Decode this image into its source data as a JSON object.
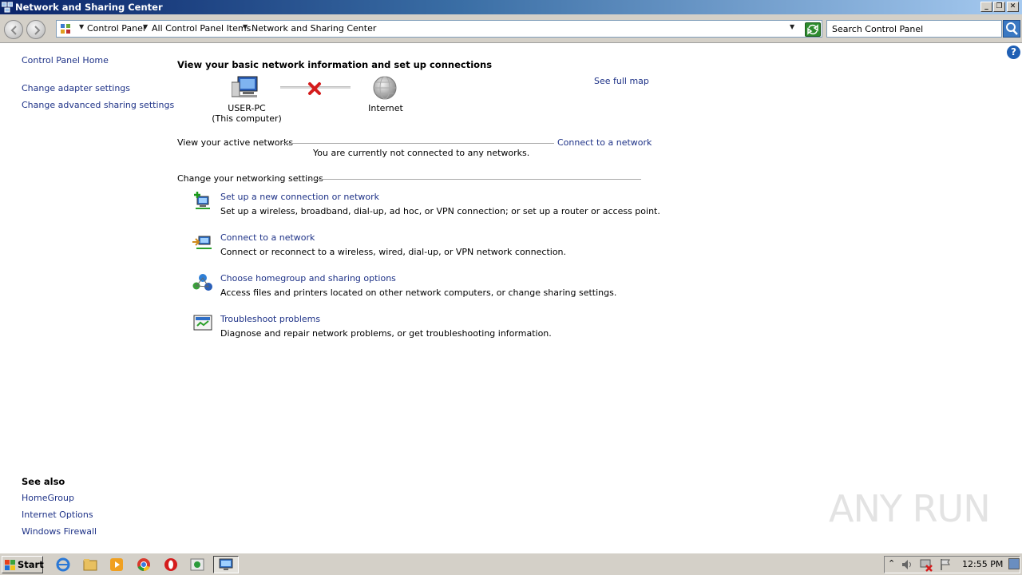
{
  "window": {
    "title": "Network and Sharing Center"
  },
  "address": {
    "crumbs": [
      "Control Panel",
      "All Control Panel Items",
      "Network and Sharing Center"
    ],
    "search_placeholder": "Search Control Panel"
  },
  "sidebar": {
    "home": "Control Panel Home",
    "links": [
      "Change adapter settings",
      "Change advanced sharing settings"
    ],
    "see_also_heading": "See also",
    "see_also": [
      "HomeGroup",
      "Internet Options",
      "Windows Firewall"
    ]
  },
  "main": {
    "title": "View your basic network information and set up connections",
    "see_full_map": "See full map",
    "computer_name": "USER-PC",
    "computer_sub": "(This computer)",
    "internet_label": "Internet",
    "active_heading": "View your active networks",
    "connect_link": "Connect to a network",
    "not_connected": "You are currently not connected to any networks.",
    "settings_heading": "Change your networking settings",
    "tasks": [
      {
        "link": "Set up a new connection or network",
        "desc": "Set up a wireless, broadband, dial-up, ad hoc, or VPN connection; or set up a router or access point.",
        "icon": "new-connection-icon"
      },
      {
        "link": "Connect to a network",
        "desc": "Connect or reconnect to a wireless, wired, dial-up, or VPN network connection.",
        "icon": "connect-network-icon"
      },
      {
        "link": "Choose homegroup and sharing options",
        "desc": "Access files and printers located on other network computers, or change sharing settings.",
        "icon": "homegroup-icon"
      },
      {
        "link": "Troubleshoot problems",
        "desc": "Diagnose and repair network problems, or get troubleshooting information.",
        "icon": "troubleshoot-icon"
      }
    ]
  },
  "watermark": "ANY RUN",
  "taskbar": {
    "start": "Start",
    "clock": "12:55 PM"
  },
  "colors": {
    "link": "#1e3287",
    "titlebar_start": "#0a246a",
    "taskbar": "#d4d0c8"
  }
}
